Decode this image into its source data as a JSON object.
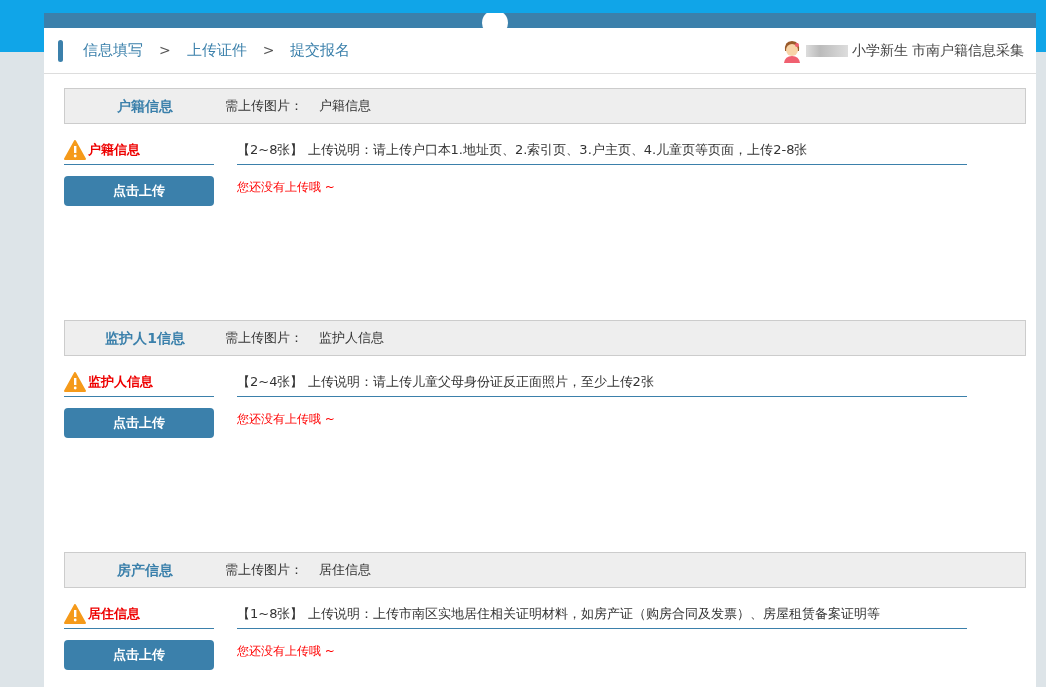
{
  "breadcrumb": [
    {
      "label": "信息填写"
    },
    {
      "label": "上传证件"
    },
    {
      "label": "提交报名"
    }
  ],
  "breadcrumb_separator": ">",
  "user": {
    "info": "小学新生 市南户籍信息采集"
  },
  "sections": [
    {
      "title": "户籍信息",
      "required_label": "需上传图片：",
      "required_value": "户籍信息",
      "item_label": "户籍信息",
      "description": "【2~8张】 上传说明：请上传户口本1.地址页、2.索引页、3.户主页、4.儿童页等页面，上传2-8张",
      "button": "点击上传",
      "status": "您还没有上传哦 ~"
    },
    {
      "title": "监护人1信息",
      "required_label": "需上传图片：",
      "required_value": "监护人信息",
      "item_label": "监护人信息",
      "description": "【2~4张】 上传说明：请上传儿童父母身份证反正面照片，至少上传2张",
      "button": "点击上传",
      "status": "您还没有上传哦 ~"
    },
    {
      "title": "房产信息",
      "required_label": "需上传图片：",
      "required_value": "居住信息",
      "item_label": "居住信息",
      "description": "【1~8张】 上传说明：上传市南区实地居住相关证明材料，如房产证（购房合同及发票）、房屋租赁备案证明等",
      "button": "点击上传",
      "status": "您还没有上传哦 ~"
    }
  ]
}
